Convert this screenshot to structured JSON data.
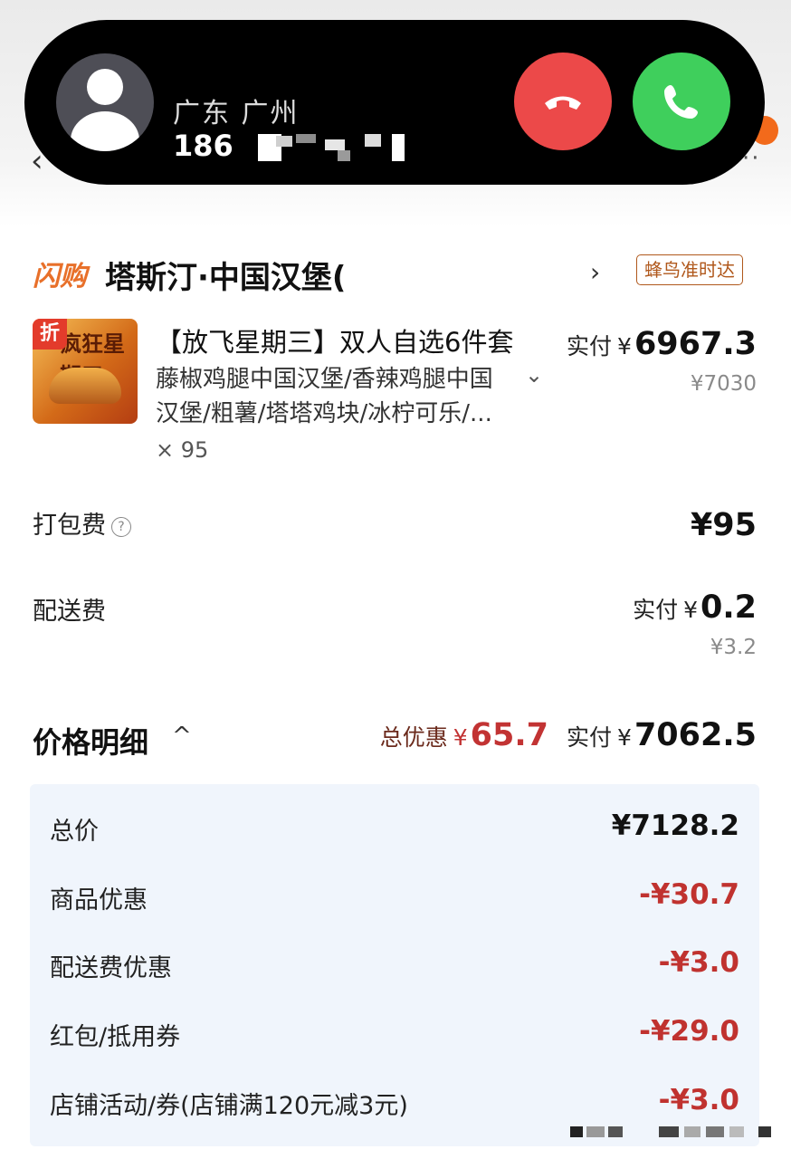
{
  "call": {
    "location": "广东 广州",
    "number_visible": "186",
    "decline_icon": "phone-hangup-icon",
    "accept_icon": "phone-icon",
    "decline_color": "#ec4949",
    "accept_color": "#3fcf5c"
  },
  "store": {
    "brand": "闪购",
    "name": "塔斯汀·中国汉堡(",
    "badge": "蜂鸟准时达",
    "chevron": "›"
  },
  "product": {
    "image_title": "疯狂星期三",
    "tag": "折",
    "title": "【放飞星期三】双人自选6件套",
    "desc_line1": "藤椒鸡腿中国汉堡/香辣鸡腿中国",
    "desc_line2": "汉堡/粗薯/塔塔鸡块/冰柠可乐/...",
    "qty": "× 95",
    "paid_label": "实付",
    "yen": "¥",
    "paid_value": "6967.3",
    "original": "¥7030"
  },
  "packing": {
    "label": "打包费",
    "help": "?",
    "value": "¥95"
  },
  "delivery": {
    "label": "配送费",
    "paid_label": "实付",
    "yen": "¥",
    "paid_value": "0.2",
    "original": "¥3.2"
  },
  "summary": {
    "title": "价格明细",
    "chevron": "^",
    "discount_label": "总优惠",
    "discount_yen": "¥",
    "discount_value": "65.7",
    "paid_label": "实付",
    "paid_yen": "¥",
    "paid_value": "7062.5"
  },
  "details": [
    {
      "label": "总价",
      "value": "¥7128.2"
    },
    {
      "label": "商品优惠",
      "value": "-¥30.7"
    },
    {
      "label": "配送费优惠",
      "value": "-¥3.0"
    },
    {
      "label": "红包/抵用券",
      "value": "-¥29.0"
    },
    {
      "label": "店铺活动/券(店铺满120元减3元)",
      "value": "-¥3.0"
    }
  ],
  "colors": {
    "discount_red": "#c0322f",
    "brand_orange": "#e8702a"
  }
}
